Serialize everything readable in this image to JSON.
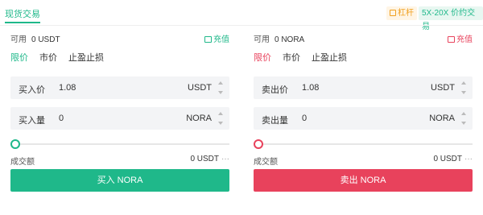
{
  "header": {
    "spot_tab": "现货交易",
    "leverage_badge": "杠杆",
    "leverage_promo": "5X-20X 价约交易"
  },
  "buy": {
    "available_label": "可用",
    "available_value": "0 USDT",
    "recharge_label": "充值",
    "tabs": [
      "限价",
      "市价",
      "止盈止损"
    ],
    "price_label": "买入价",
    "price_value": "1.08",
    "price_unit": "USDT",
    "qty_label": "买入量",
    "qty_value": "0",
    "qty_unit": "NORA",
    "amount_label": "成交额",
    "amount_value": "0 USDT",
    "amount_suffix": "···",
    "button_label": "买入 NORA",
    "slider_percent": 0
  },
  "sell": {
    "available_label": "可用",
    "available_value": "0 NORA",
    "recharge_label": "充值",
    "tabs": [
      "限价",
      "市价",
      "止盈止损"
    ],
    "price_label": "卖出价",
    "price_value": "1.08",
    "price_unit": "USDT",
    "qty_label": "卖出量",
    "qty_value": "0",
    "qty_unit": "NORA",
    "amount_label": "成交额",
    "amount_value": "0 USDT",
    "amount_suffix": "···",
    "button_label": "卖出 NORA",
    "slider_percent": 0
  },
  "colors": {
    "buy_accent": "#1fb88a",
    "sell_accent": "#e8425c",
    "leverage_accent": "#f0a020"
  },
  "icons": {
    "recharge": "recharge-icon",
    "leverage": "leverage-icon",
    "stepper": "stepper-icon"
  }
}
